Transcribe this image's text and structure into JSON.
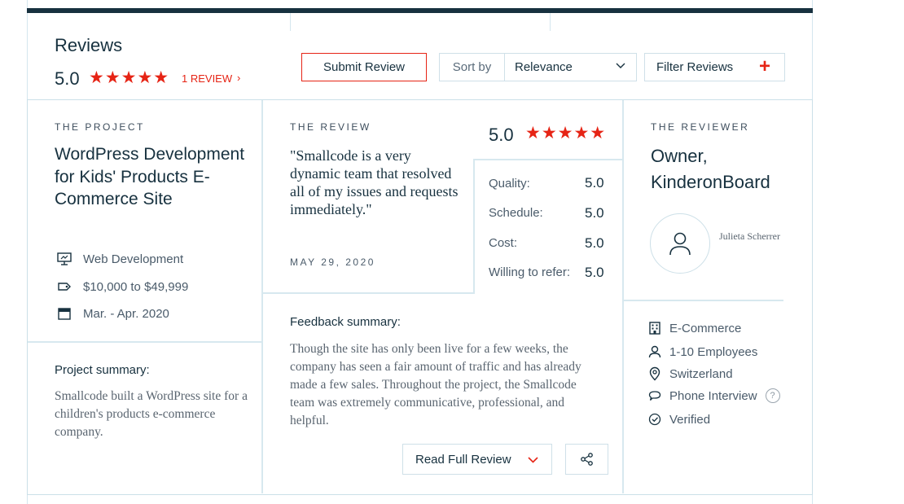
{
  "header": {
    "title": "Reviews",
    "overall_score": "5.0",
    "stars": "★★★★★",
    "review_count": "1 REVIEW",
    "review_count_chevron": "›",
    "submit_label": "Submit Review",
    "sort_label": "Sort by",
    "sort_value": "Relevance",
    "filter_label": "Filter Reviews",
    "filter_plus": "+"
  },
  "project": {
    "section_label": "THE PROJECT",
    "title": "WordPress Development for Kids' Products E-Commerce Site",
    "category": "Web Development",
    "budget": "$10,000 to $49,999",
    "dates": "Mar. - Apr. 2020",
    "summary_heading": "Project summary:",
    "summary": "Smallcode built a WordPress site for a children's products e-commerce company."
  },
  "review": {
    "section_label": "THE REVIEW",
    "quote": "\"Smallcode is a very dynamic team that resolved all of my issues and requests immediately.\"",
    "date": "MAY 29, 2020",
    "score": "5.0",
    "stars": "★★★★★",
    "ratings": [
      {
        "label": "Quality:",
        "value": "5.0"
      },
      {
        "label": "Schedule:",
        "value": "5.0"
      },
      {
        "label": "Cost:",
        "value": "5.0"
      },
      {
        "label": "Willing to refer:",
        "value": "5.0"
      }
    ],
    "feedback_heading": "Feedback summary:",
    "feedback": "Though the site has only been live for a few weeks, the company has seen a fair amount of traffic and has already made a few sales. Throughout the project, the Smallcode team was extremely communicative, professional, and helpful.",
    "read_full_label": "Read Full Review"
  },
  "reviewer": {
    "section_label": "THE REVIEWER",
    "title": "Owner, KinderonBoard",
    "name": "Julieta Scherrer",
    "industry": "E-Commerce",
    "employees": "1-10 Employees",
    "location": "Switzerland",
    "interview_type": "Phone Interview",
    "help": "?",
    "verified": "Verified"
  },
  "colors": {
    "accent": "#e62415",
    "navy": "#17313f",
    "border": "#cfe0e8"
  },
  "icons": [
    "presentation-icon",
    "tag-icon",
    "calendar-icon",
    "chevron-down-icon",
    "share-icon",
    "user-icon",
    "building-icon",
    "person-icon",
    "location-pin-icon",
    "chat-icon",
    "check-circle-icon",
    "help-icon"
  ]
}
